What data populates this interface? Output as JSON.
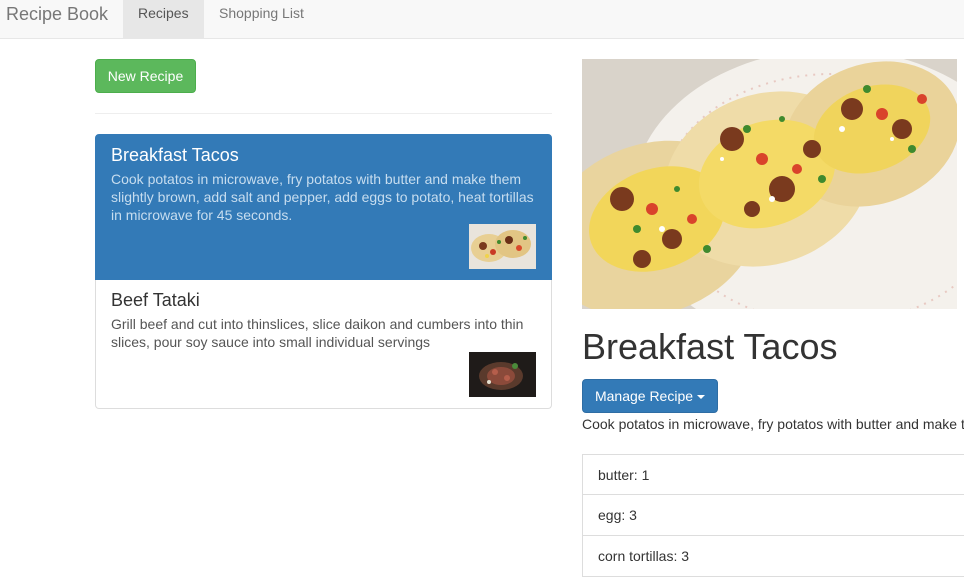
{
  "navbar": {
    "brand": "Recipe Book",
    "tabs": [
      {
        "label": "Recipes",
        "active": true
      },
      {
        "label": "Shopping List",
        "active": false
      }
    ]
  },
  "recipe_list": {
    "new_button_label": "New Recipe",
    "items": [
      {
        "name": "Breakfast Tacos",
        "description": "Cook potatos in microwave, fry potatos with butter and make them slightly brown, add salt and pepper, add eggs to potato, heat tortillas in microwave for 45 seconds.",
        "selected": true
      },
      {
        "name": "Beef Tataki",
        "description": "Grill beef and cut into thinslices, slice daikon and cumbers into thin slices, pour soy sauce into small individual servings",
        "selected": false
      }
    ]
  },
  "detail": {
    "title": "Breakfast Tacos",
    "manage_button_label": "Manage Recipe",
    "description": "Cook potatos in microwave, fry potatos with butter and make them slightly brown, add salt and pepper, add eggs to potato, heat tortillas in microwave for 45 seconds.",
    "ingredients": [
      "butter: 1",
      "egg: 3",
      "corn tortillas: 3"
    ]
  },
  "colors": {
    "success": "#5cb85c",
    "primary": "#337ab7",
    "navbar_bg": "#f8f8f8"
  }
}
